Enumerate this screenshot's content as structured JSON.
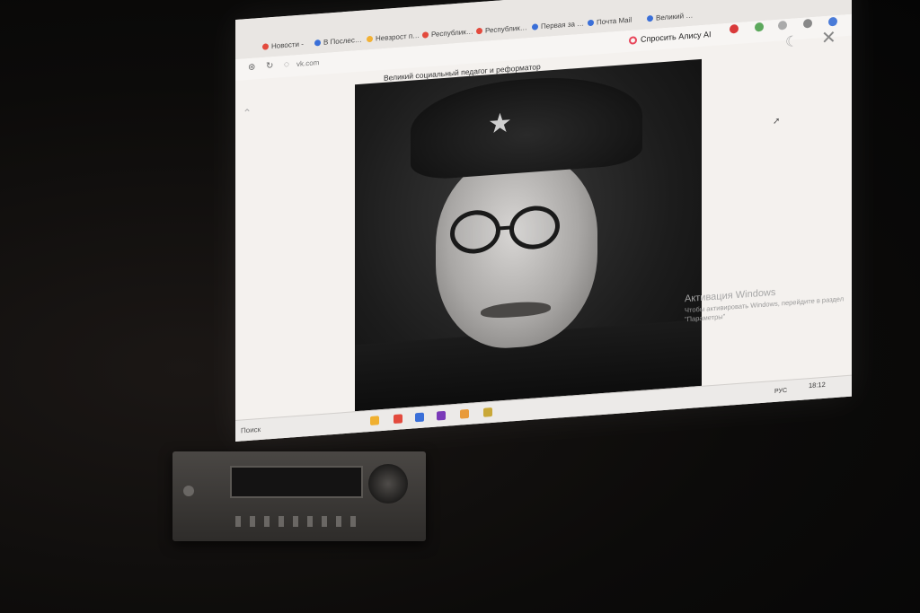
{
  "browser": {
    "tabs": [
      {
        "label": "Новости -",
        "color": "#e34a3d"
      },
      {
        "label": "В Послес…",
        "color": "#3a6fd8"
      },
      {
        "label": "Невзрост п…",
        "color": "#f2b134"
      },
      {
        "label": "Республик…",
        "color": "#e34a3d"
      },
      {
        "label": "Республик…",
        "color": "#e34a3d"
      },
      {
        "label": "Первая за …",
        "color": "#3a6fd8"
      },
      {
        "label": "Почта Mail",
        "color": "#3a6fd8"
      },
      {
        "label": "Великий …",
        "color": "#3a6fd8"
      }
    ],
    "url": "vk.com",
    "page_title": "Великий социальный педагог и реформатор",
    "ask_alice_label": "Спросить Алису AI",
    "accent_color": "#e8455a"
  },
  "watermark": {
    "title": "Активация Windows",
    "text": "Чтобы активировать Windows, перейдите в раздел \"Параметры\""
  },
  "taskbar": {
    "search_label": "Поиск",
    "language": "РУС",
    "time": "18:12"
  }
}
